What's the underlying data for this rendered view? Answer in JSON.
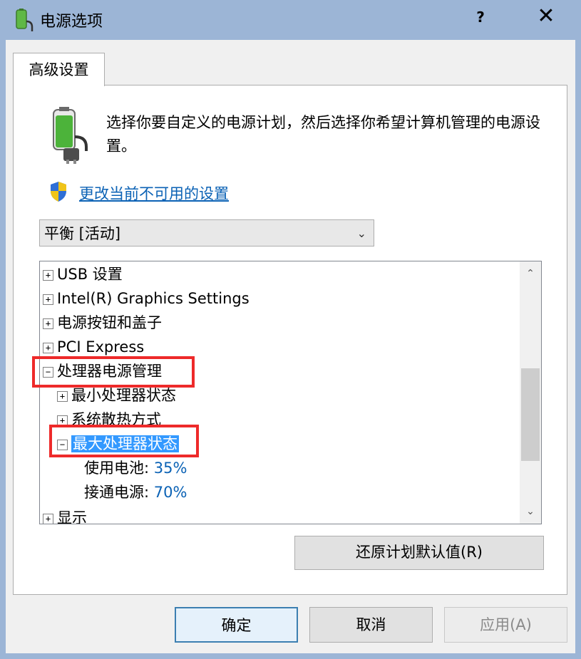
{
  "window": {
    "title": "电源选项",
    "help_label": "?",
    "close_label": "✕"
  },
  "tabs": [
    {
      "label": "高级设置"
    }
  ],
  "description": "选择你要自定义的电源计划，然后选择你希望计算机管理的电源设置。",
  "change_link": "更改当前不可用的设置",
  "plan_select": {
    "value": "平衡 [活动]",
    "arrow": "⌄"
  },
  "tree": {
    "items": [
      {
        "expander": "+",
        "label": "USB 设置"
      },
      {
        "expander": "+",
        "label": "Intel(R) Graphics Settings"
      },
      {
        "expander": "+",
        "label": "电源按钮和盖子"
      },
      {
        "expander": "+",
        "label": "PCI Express"
      },
      {
        "expander": "−",
        "label": "处理器电源管理"
      },
      {
        "expander": "+",
        "label": "最小处理器状态"
      },
      {
        "expander": "+",
        "label": "系统散热方式"
      },
      {
        "expander": "−",
        "label": "最大处理器状态"
      },
      {
        "label": "使用电池:",
        "value": "35%"
      },
      {
        "label": "接通电源:",
        "value": "70%"
      },
      {
        "expander": "+",
        "label": "显示"
      }
    ]
  },
  "scrollbar": {
    "up": "⌃",
    "down": "⌄"
  },
  "buttons": {
    "restore": "还原计划默认值(R)",
    "ok": "确定",
    "cancel": "取消",
    "apply": "应用(A)"
  },
  "colors": {
    "titlebar": "#9cb5d6",
    "link": "#0b62b5",
    "selection": "#3399ff",
    "highlight_box": "#ee2a2a"
  }
}
